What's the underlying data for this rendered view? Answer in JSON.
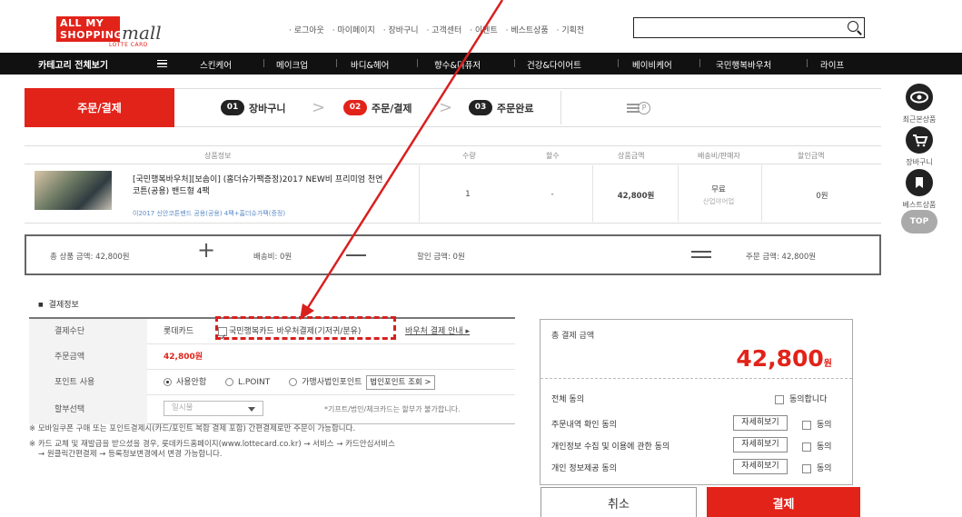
{
  "header": {
    "logo_line1": "ALL MY",
    "logo_line2": "SHOPPING",
    "logo_mall": "mall",
    "logo_sub": "LOTTE CARD",
    "top_links": [
      "· 로그아웃",
      "· 마이페이지",
      "· 장바구니",
      "· 고객센터",
      "· 이벤트",
      "· 베스트상품",
      "· 기획전"
    ],
    "search_value": ""
  },
  "category_nav": {
    "all_label": "카테고리 전체보기",
    "items": [
      "스킨케어",
      "메이크업",
      "바디&헤어",
      "향수&디퓨저",
      "건강&다이어트",
      "베이비케어",
      "국민행복바우처",
      "라이프"
    ]
  },
  "steps": {
    "current_title": "주문/결제",
    "items": [
      {
        "num": "01",
        "label": "장바구니"
      },
      {
        "num": "02",
        "label": "주문/결제"
      },
      {
        "num": "03",
        "label": "주문완료"
      }
    ]
  },
  "quick_menu": {
    "recent": "최근본상품",
    "cart": "장바구니",
    "best": "베스트상품",
    "top": "TOP"
  },
  "table": {
    "headers": [
      "상품정보",
      "수량",
      "할수",
      "상품금액",
      "배송비/판매자",
      "할인금액"
    ],
    "row": {
      "name": "[국민행복바우처][보솜이] (홈더슈가팩증정)2017 NEW비 프리미엄 천연코튼(공용) 밴드형 4팩",
      "sub": "이2017 신안코튼밴드 공용(공용) 4팩+홈더슈가팩(증정)",
      "qty": "1",
      "installment": "-",
      "price": "42,800원",
      "shipping": "무료",
      "seller": "산업야어업",
      "discount": "0원"
    }
  },
  "totals": {
    "product_total": "총 상품 금액: 42,800원",
    "shipping": "배송비: 0원",
    "discount": "할인 금액: 0원",
    "order_total": "주문 금액: 42,800원"
  },
  "payment": {
    "section_title": "결제정보",
    "method_label": "결제수단",
    "method_value": "롯데카드",
    "voucher_option": "국민행복카드 바우처결제(기저귀/분유)",
    "voucher_guide": "바우처 결제 안내",
    "amount_label": "주문금액",
    "amount_value": "42,800원",
    "points_label": "포인트 사용",
    "points_options": [
      "사용안함",
      "L.POINT",
      "가맹사법인포인트"
    ],
    "points_button": "법인포인트 조회 >",
    "installment_label": "할부선택",
    "installment_value": "일시불",
    "installment_note": "*기프트/법인/체크카드는 할부가 불가합니다.",
    "note1": "※ 모바일쿠폰 구매 또는 포인트결제시(카드/포인트 복합 결제 포함) 간편결제로만 주문이 가능합니다.",
    "note2": "※ 카드 교체 및 재발급을 받으셨을 경우, 롯데카드홈페이지(www.lottecard.co.kr) → 서비스 → 카드안심서비스",
    "note3": "→ 원클릭간편결제 → 등록정보변경에서 변경 가능합니다."
  },
  "summary": {
    "total_label": "총 결제 금액",
    "total_amount": "42,800",
    "total_unit": "원",
    "agree_all": "전체 동의",
    "agree_all_check": "동의합니다",
    "agreements": [
      {
        "label": "주문내역 확인 동의",
        "button": "자세히보기",
        "check": "동의"
      },
      {
        "label": "개인정보 수집 및 이용에 관한 동의",
        "button": "자세히보기",
        "check": "동의"
      },
      {
        "label": "개인 정보제공 동의",
        "button": "자세히보기",
        "check": "동의"
      }
    ],
    "cancel": "취소",
    "pay": "결제"
  },
  "colors": {
    "accent": "#e2231a",
    "annotation": "#d8201f"
  }
}
